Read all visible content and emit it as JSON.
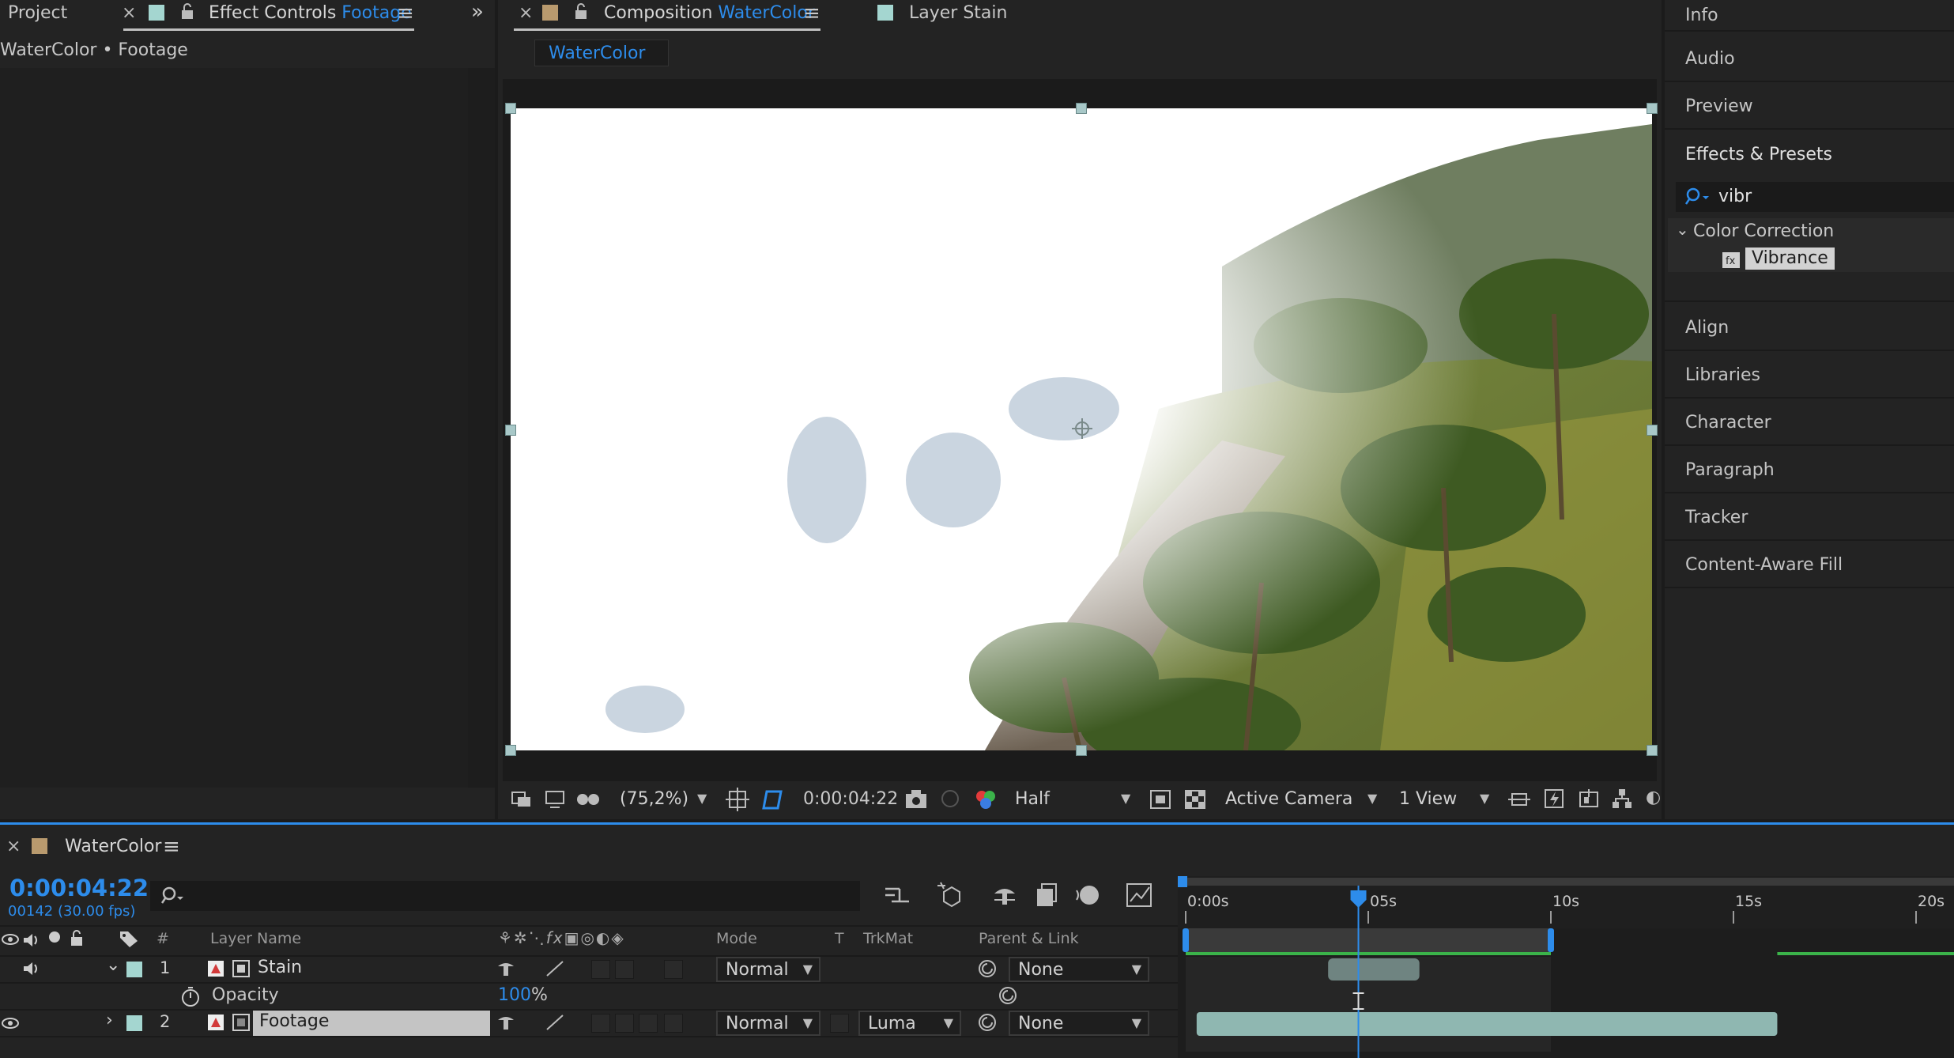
{
  "left_panel": {
    "tab_project": "Project",
    "tab_effect_controls_prefix": "Effect Controls",
    "tab_effect_controls_layer": "Footage",
    "subtitle": "WaterColor • Footage"
  },
  "comp_panel": {
    "tab_composition_prefix": "Composition",
    "tab_composition_name": "WaterColor",
    "tab_layer": "Layer Stain",
    "breadcrumb": "WaterColor",
    "toolbar": {
      "zoom": "(75,2%)",
      "timecode": "0:00:04:22",
      "resolution": "Half",
      "camera": "Active Camera",
      "views": "1 View"
    }
  },
  "right_panel": {
    "items_top": [
      "Info",
      "Audio",
      "Preview"
    ],
    "effects_presets": {
      "title": "Effects & Presets",
      "search_value": "vibr",
      "category": "Color Correction",
      "effect": "Vibrance"
    },
    "items_bottom": [
      "Align",
      "Libraries",
      "Character",
      "Paragraph",
      "Tracker",
      "Content-Aware Fill"
    ]
  },
  "timeline": {
    "comp_name": "WaterColor",
    "current_time": "0:00:04:22",
    "frame_info": "00142 (30.00 fps)",
    "columns": {
      "number": "#",
      "layer_name": "Layer Name",
      "mode": "Mode",
      "t": "T",
      "trkmat": "TrkMat",
      "parent": "Parent & Link"
    },
    "layers": [
      {
        "index": "1",
        "name": "Stain",
        "mode": "Normal",
        "trkmat": "",
        "parent": "None"
      },
      {
        "index": "2",
        "name": "Footage",
        "mode": "Normal",
        "trkmat": "Luma",
        "parent": "None"
      }
    ],
    "opacity": {
      "label": "Opacity",
      "value": "100",
      "unit": "%"
    },
    "ruler_labels": [
      "0:00s",
      "05s",
      "10s",
      "15s",
      "20s"
    ],
    "playhead_seconds": 4.73,
    "work_area_seconds": [
      0,
      10
    ],
    "stain_bar_seconds": [
      3.9,
      6.4
    ],
    "footage_bar_seconds": [
      0.3,
      16.2
    ]
  },
  "colors": {
    "accent": "#2d8ceb",
    "label_aqua": "#a4d6d0",
    "label_tan": "#b99a6e",
    "work_area": "#3a3a3a",
    "footage_bar": "#8fb7b1"
  }
}
